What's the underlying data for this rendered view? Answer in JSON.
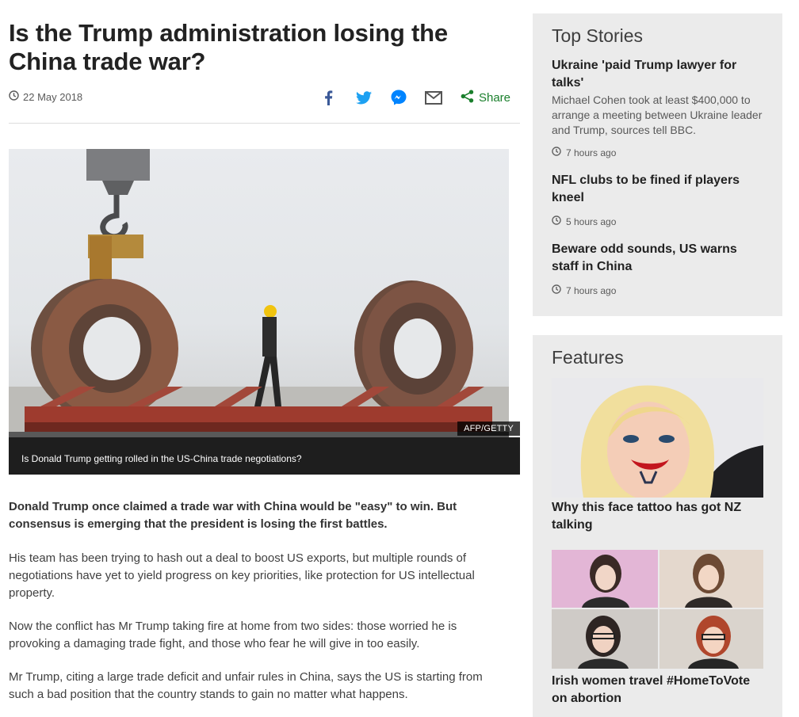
{
  "article": {
    "headline": "Is the Trump administration losing the China trade war?",
    "date": "22 May 2018",
    "share_label": "Share",
    "image_credit": "AFP/GETTY",
    "image_caption": "Is Donald Trump getting rolled in the US-China trade negotiations?",
    "lead": "Donald Trump once claimed a trade war with China would be \"easy\" to win. But consensus is emerging that the president is losing the first battles.",
    "paragraphs": [
      "His team has been trying to hash out a deal to boost US exports, but multiple rounds of negotiations have yet to yield progress on key priorities, like protection for US intellectual property.",
      "Now the conflict has Mr Trump taking fire at home from two sides: those worried he is provoking a damaging trade fight, and those who fear he will give in too easily.",
      "Mr Trump, citing a large trade deficit and unfair rules in China, says the US is starting from such a bad position that the country stands to gain no matter what happens."
    ]
  },
  "top_stories": {
    "title": "Top Stories",
    "items": [
      {
        "title": "Ukraine 'paid Trump lawyer for talks'",
        "summary": "Michael Cohen took at least $400,000 to arrange a meeting between Ukraine leader and Trump, sources tell BBC.",
        "time": "7 hours ago"
      },
      {
        "title": "NFL clubs to be fined if players kneel",
        "summary": "",
        "time": "5 hours ago"
      },
      {
        "title": "Beware odd sounds, US warns staff in China",
        "summary": "",
        "time": "7 hours ago"
      }
    ]
  },
  "features": {
    "title": "Features",
    "items": [
      {
        "title": "Why this face tattoo has got NZ talking"
      },
      {
        "title": "Irish women travel #HomeToVote on abortion"
      }
    ]
  },
  "colors": {
    "share_green": "#1a7f2c",
    "facebook": "#3b5998",
    "twitter": "#1da1f2",
    "messenger": "#0084ff",
    "panel_bg": "#ebebeb"
  },
  "icons": [
    "clock-icon",
    "facebook-icon",
    "twitter-icon",
    "messenger-icon",
    "email-icon",
    "share-icon"
  ]
}
